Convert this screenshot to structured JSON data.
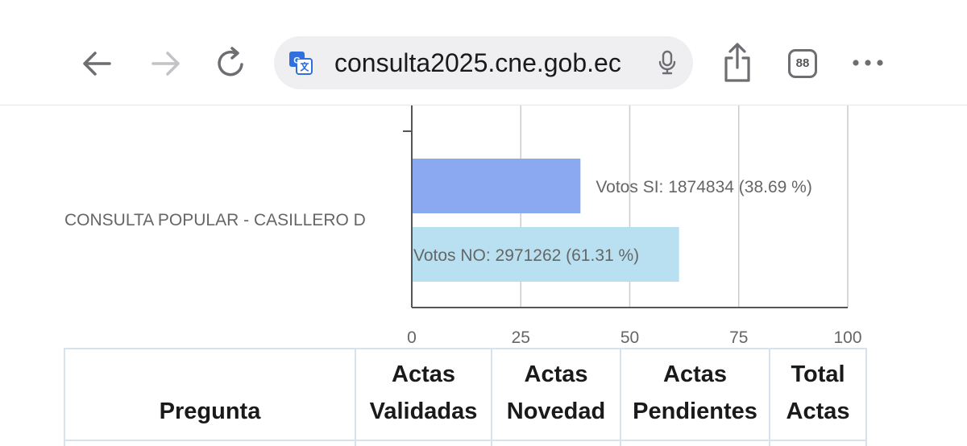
{
  "browser": {
    "url": "consulta2025.cne.gob.ec",
    "tab_count": "88",
    "icons": [
      "back-arrow-icon",
      "forward-arrow-icon",
      "reload-icon",
      "translate-icon",
      "microphone-icon",
      "share-icon",
      "tabs-icon",
      "more-icon"
    ]
  },
  "chart_data": {
    "type": "bar",
    "orientation": "horizontal",
    "categories": [
      "CONSULTA POPULAR - CASILLERO D"
    ],
    "series": [
      {
        "name": "Votos SI",
        "values": [
          38.69
        ],
        "votes": [
          1874834
        ],
        "label": "Votos SI: 1874834 (38.69 %)",
        "color": "#8aa9f0"
      },
      {
        "name": "Votos NO",
        "values": [
          61.31
        ],
        "votes": [
          2971262
        ],
        "label": "Votos NO: 2971262 (61.31 %)",
        "color": "#b9e0f0"
      }
    ],
    "xlim": [
      0,
      100
    ],
    "xticks": [
      "0",
      "25",
      "50",
      "75",
      "100"
    ],
    "grid": true
  },
  "table": {
    "headers": [
      {
        "lines": [
          "Pregunta"
        ]
      },
      {
        "lines": [
          "Actas",
          "Validadas"
        ]
      },
      {
        "lines": [
          "Actas",
          "Novedad"
        ]
      },
      {
        "lines": [
          "Actas",
          "Pendientes"
        ]
      },
      {
        "lines": [
          "Total",
          "Actas"
        ]
      }
    ]
  }
}
